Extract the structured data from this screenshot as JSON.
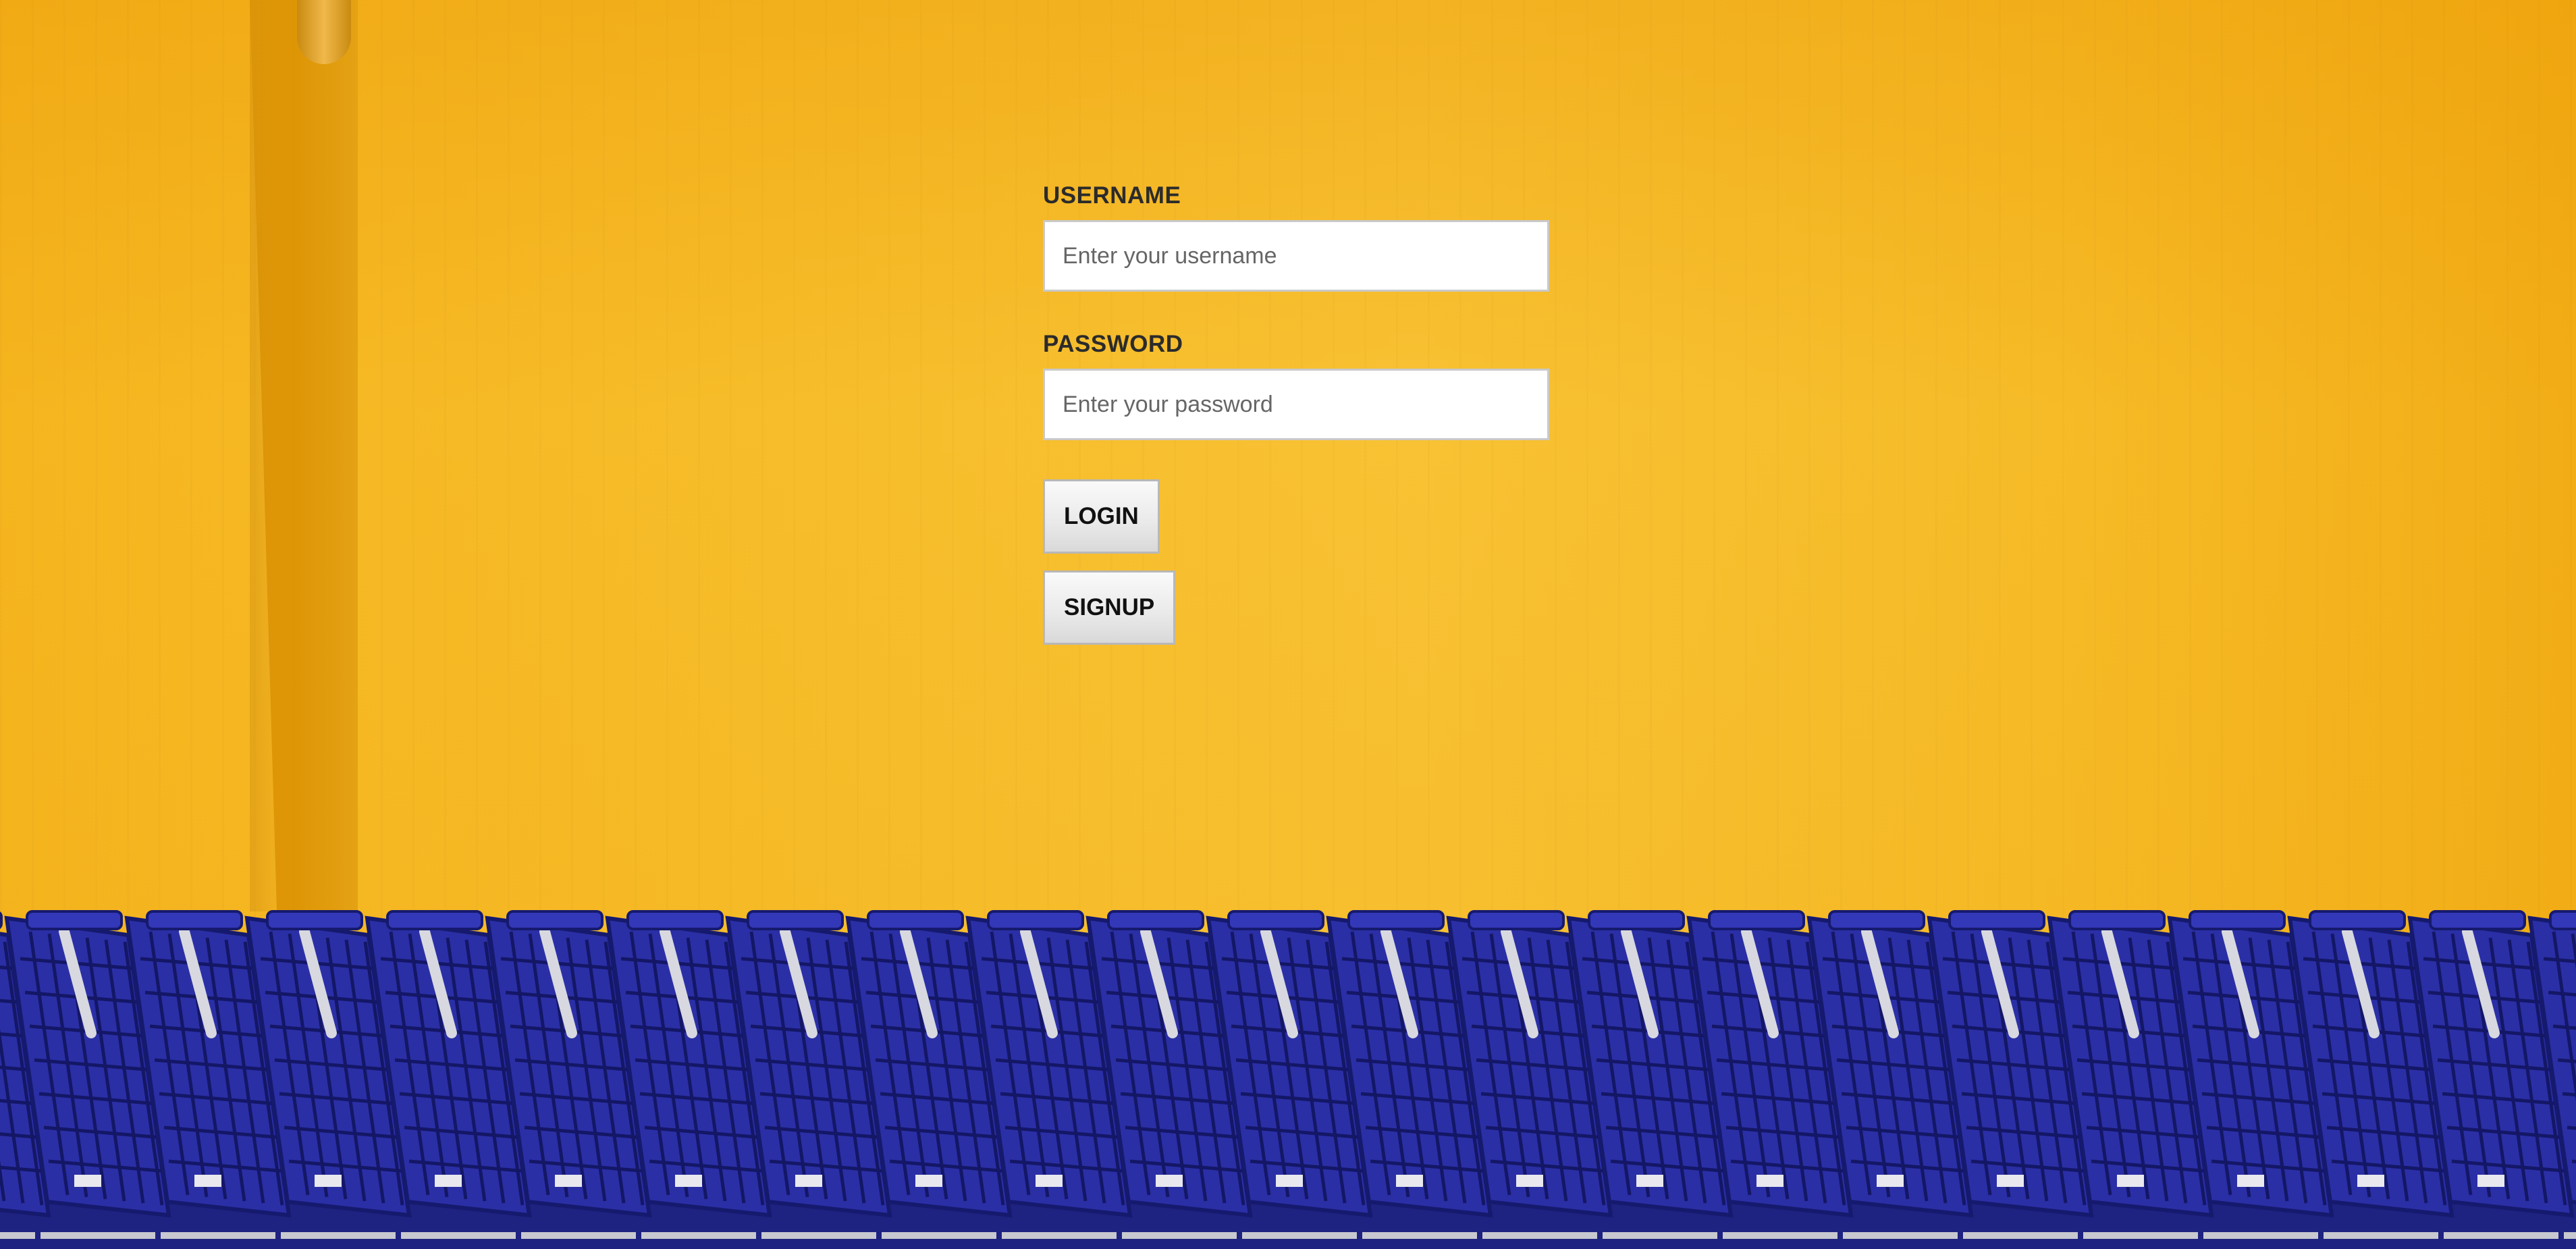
{
  "login": {
    "username_label": "USERNAME",
    "username_placeholder": "Enter your username",
    "username_value": "",
    "password_label": "PASSWORD",
    "password_placeholder": "Enter your password",
    "password_value": "",
    "login_button": "LOGIN",
    "signup_button": "SIGNUP"
  },
  "background": {
    "wall_color": "#f7bd2a",
    "cart_color": "#2b2fa6"
  }
}
